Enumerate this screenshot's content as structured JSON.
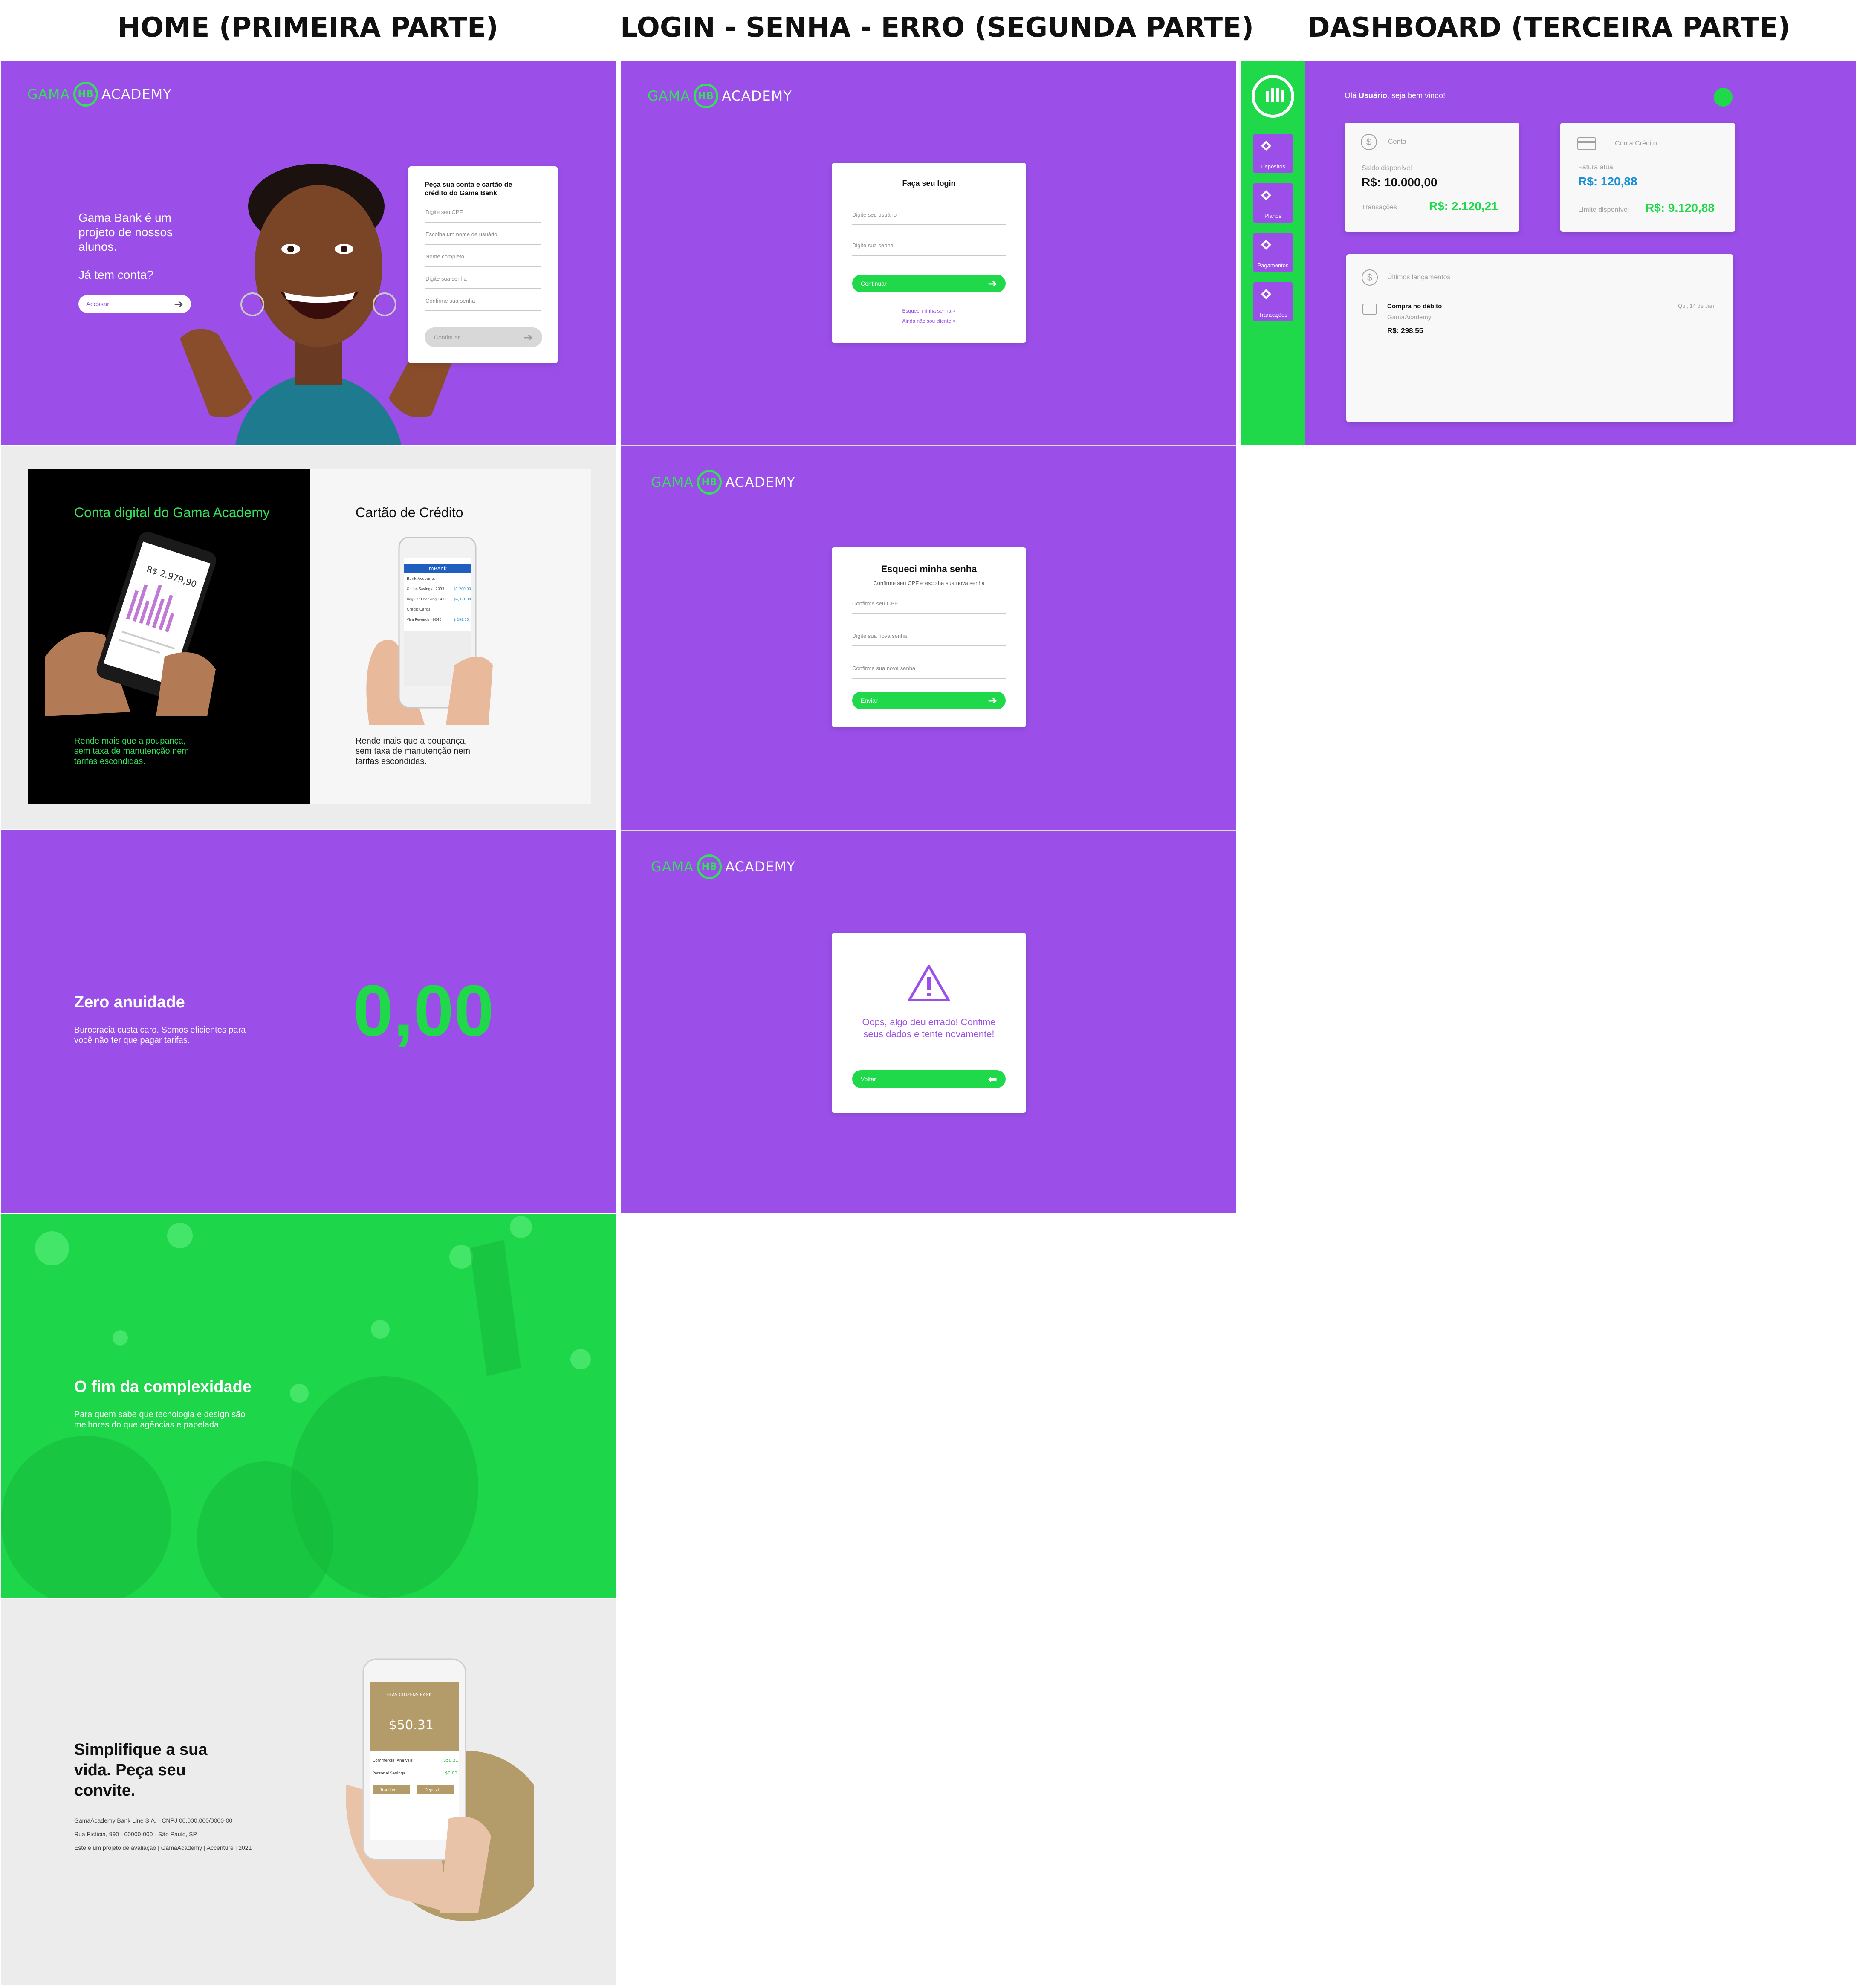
{
  "column_titles": {
    "home": "HOME (PRIMEIRA PARTE)",
    "login": "LOGIN - SENHA - ERRO (SEGUNDA PARTE)",
    "dashboard": "DASHBOARD (TERCEIRA PARTE)"
  },
  "logo": {
    "left": "GAMA",
    "mid": "HB",
    "right": "ACADEMY"
  },
  "home": {
    "hero": {
      "text1": "Gama Bank é um projeto de nossos alunos.",
      "text2": "Já tem conta?",
      "access_button": "Acessar",
      "form_title": "Peça sua conta e cartão de crédito do Gama Bank",
      "fields": [
        "Digite seu CPF",
        "Escolha um nome de usuário",
        "Nome completo",
        "Digite sua senha",
        "Confirme sua senha"
      ],
      "submit": "Continuar"
    },
    "features": {
      "left_title": "Conta digital do Gama Academy",
      "left_text": "Rende mais que a poupança, sem taxa de manutenção nem tarifas escondidas.",
      "phone_amount": "R$ 2.979,90",
      "right_title": "Cartão de Crédito",
      "right_text": "Rende mais que a poupança, sem taxa de manutenção nem tarifas escondidas.",
      "phone_header": "mBank",
      "phone_rows": [
        "Bank Accounts",
        "Online Savings - 2093",
        "Regular Checking - 4108",
        "Credit Cards",
        "Visa Rewards - 9046"
      ],
      "phone_values": [
        "$1,200.00",
        "$4,321.00",
        "$ 299.00"
      ]
    },
    "annuity": {
      "title": "Zero anuidade",
      "text": "Burocracia custa caro. Somos eficientes para você não ter que pagar tarifas.",
      "big_value": "0,00"
    },
    "complexity": {
      "title": "O fim da complexidade",
      "text": "Para quem sabe que tecnologia e design são melhores do que agências e papelada."
    },
    "footer": {
      "title": "Simplifique a sua vida. Peça seu convite.",
      "line1": "GamaAcademy Bank Line S.A. - CNPJ 00.000.000/0000-00",
      "line2": "Rua Fictícia, 990 - 00000-000 - São Paulo, SP",
      "line3": "Este é um projeto de avaliação | GamaAcademy | Accenture | 2021",
      "phone_bank": "TEXAS CITIZENS BANK",
      "phone_amount": "$50.31",
      "phone_row1": "Commercial Analysis",
      "phone_row2": "Personal Savings",
      "phone_val1": "$50.31",
      "phone_val2": "$0.00",
      "phone_btn1": "Transfer",
      "phone_btn2": "Deposit"
    }
  },
  "login": {
    "login_card": {
      "title": "Faça seu login",
      "user_placeholder": "Digite seu usuário",
      "pass_placeholder": "Digite sua senha",
      "button": "Continuar",
      "forgot": "Esqueci minha senha >",
      "not_client": "Ainda não sou cliente >"
    },
    "forgot_card": {
      "title": "Esqueci minha senha",
      "subtitle": "Confirme seu CPF e escolha sua nova senha",
      "fields": [
        "Confirme seu CPF",
        "Digite sua nova senha",
        "Confirme sua nova senha"
      ],
      "button": "Enviar"
    },
    "error_card": {
      "message": "Oops, algo deu errado! Confime seus dados e tente novamente!",
      "button": "Voltar"
    }
  },
  "dashboard": {
    "greeting_prefix": "Olá ",
    "greeting_user": "Usuário",
    "greeting_suffix": ", seja bem vindo!",
    "sidebar": [
      "Depósitos",
      "Planos",
      "Pagamentos",
      "Transações"
    ],
    "account": {
      "label": "Conta",
      "balance_label": "Saldo disponível",
      "balance": "R$: 10.000,00",
      "transactions_label": "Transações",
      "transactions": "R$: 2.120,21"
    },
    "credit": {
      "label": "Conta Crédito",
      "invoice_label": "Fatura atual",
      "invoice": "R$: 120,88",
      "limit_label": "Limite disponível",
      "limit": "R$: 9.120,88"
    },
    "recent": {
      "label": "Últimos lançamentos",
      "item_title": "Compra no débito",
      "item_sub": "GamaAcademy",
      "item_value": "R$: 298,55",
      "item_date": "Qui, 14 de Jan"
    }
  },
  "colors": {
    "purple": "#9b4fe8",
    "green": "#1fd94b",
    "blue": "#1a8fd6"
  }
}
